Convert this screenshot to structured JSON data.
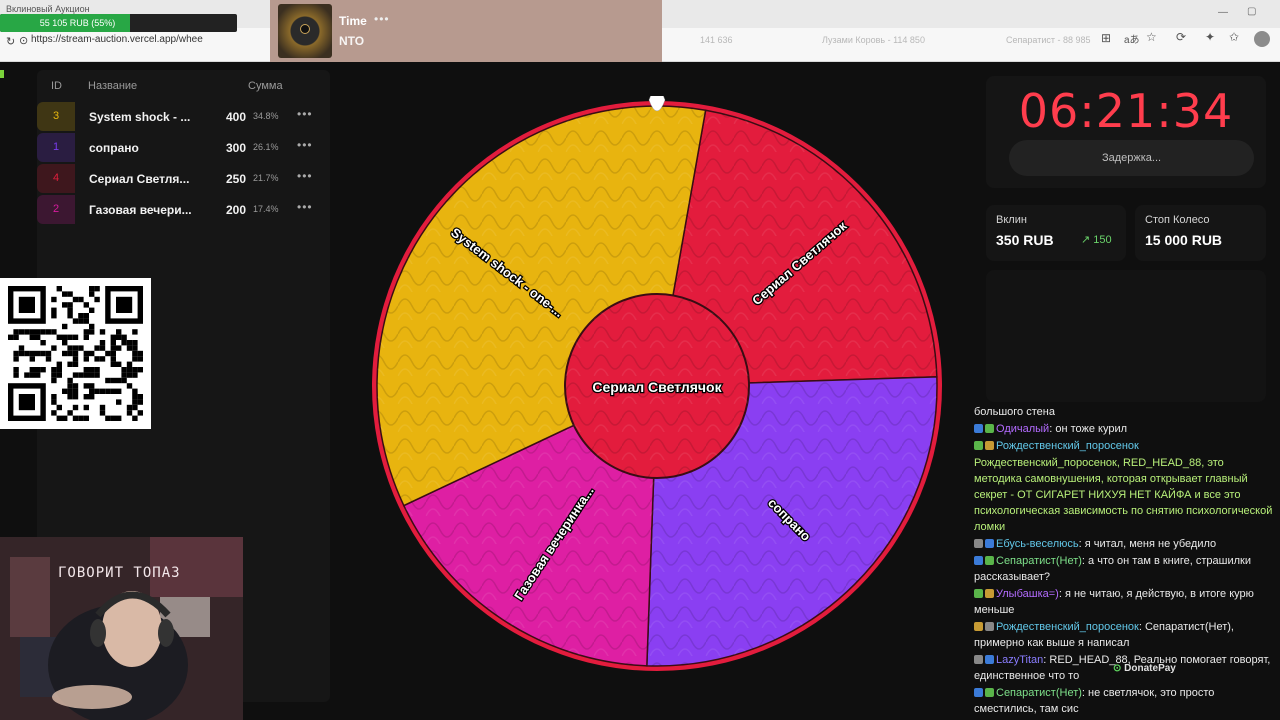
{
  "browser": {
    "tab_title": "Вклиновый Аукцион",
    "url": "https://stream-auction.vercel.app/whee",
    "ghost_text": [
      "141 636",
      "Лузами Коровь - 114 850",
      "Сепаратист - 88 985"
    ]
  },
  "auction_progress": {
    "text": "55 105 RUB (55%)",
    "fraction": 0.55,
    "color": "#28a745"
  },
  "music": {
    "title": "Time",
    "artist": "NTO",
    "more": "•••"
  },
  "table": {
    "headers": {
      "id": "ID",
      "name": "Название",
      "sum": "Сумма"
    },
    "rows": [
      {
        "id": "3",
        "name": "System shock - ...",
        "amount": "400",
        "pct": "34.8%",
        "color": "#e8b80f"
      },
      {
        "id": "1",
        "name": "сопрано",
        "amount": "300",
        "pct": "26.1%",
        "color": "#7b3cf0"
      },
      {
        "id": "4",
        "name": "Сериал Светля...",
        "amount": "250",
        "pct": "21.7%",
        "color": "#e01e3c"
      },
      {
        "id": "2",
        "name": "Газовая вечери...",
        "amount": "200",
        "pct": "17.4%",
        "color": "#d61c9e"
      }
    ]
  },
  "wheel": {
    "segments": [
      {
        "label": "Сериал Светлячок",
        "share": 0.217,
        "color": "#e31c3d"
      },
      {
        "label": "сопрано",
        "share": 0.261,
        "color": "#8a3ff2"
      },
      {
        "label": "Газовая вечеринка...",
        "share": 0.174,
        "color": "#de1fa3"
      },
      {
        "label": "System shock - one-...",
        "share": 0.348,
        "color": "#e8b40f"
      }
    ],
    "center_label": "Сериал Светлячок",
    "rim_color": "#e31c3d"
  },
  "timer": {
    "value": "06:21:34",
    "delay_label": "Задержка..."
  },
  "stats": {
    "vklin_label": "Вклин",
    "vklin_value": "350 RUB",
    "vklin_increment": "150",
    "stop_label": "Стоп Колесо",
    "stop_value": "15 000 RUB"
  },
  "webcam": {
    "overlay_text": "ГОВОРИТ ТОПАЗ"
  },
  "chat": [
    {
      "user": "",
      "text": "большого стена",
      "color": "#eaeaea"
    },
    {
      "user": "Одичалый",
      "text": "он тоже курил",
      "color": "#b36bff"
    },
    {
      "user": "Рождественский_поросенок",
      "text": "",
      "color": "#62c7e8"
    },
    {
      "user": "",
      "text": "Рождественский_поросенок, RED_HEAD_88, это методика самовнушения, которая открывает главный секрет - ОТ СИГАРЕТ НИХУЯ НЕТ КАЙФА и все это психологическая зависимость по снятию психологической ломки",
      "color": "#b8f07a"
    },
    {
      "user": "Ебусь-веселюсь",
      "text": "я читал, меня не убедило",
      "color": "#62c7e8"
    },
    {
      "user": "Сепаратист(Нет)",
      "text": "а что он там в книге, страшилки рассказывает?",
      "color": "#7ee08a"
    },
    {
      "user": "Улыбашка=)",
      "text": "я не читаю, я действую, в итоге курю меньше",
      "color": "#b36bff"
    },
    {
      "user": "Рождественский_поросенок",
      "text": "Сепаратист(Нет), примерно как выше я написал",
      "color": "#62c7e8"
    },
    {
      "user": "LazyTitan",
      "text": "RED_HEAD_88, Реально помогает говорят, единственное что то",
      "color": "#8a7dff"
    },
    {
      "user": "Сепаратист(Нет)",
      "text": "не светлячок, это просто сместились, там сис",
      "color": "#7ee08a"
    }
  ],
  "donatepay_label": "DonatePay"
}
